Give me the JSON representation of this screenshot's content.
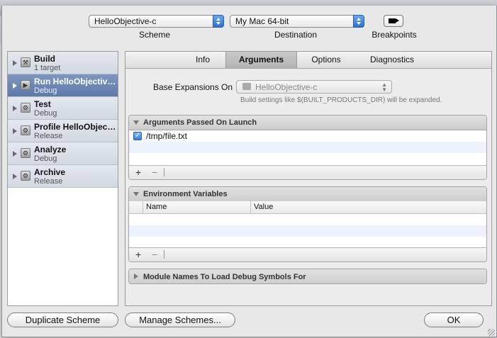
{
  "toolbar": {
    "scheme_value": "HelloObjective-c",
    "scheme_label": "Scheme",
    "destination_value": "My Mac 64-bit",
    "destination_label": "Destination",
    "breakpoints_label": "Breakpoints"
  },
  "sidebar": {
    "items": [
      {
        "name": "Build",
        "sub": "1 target",
        "icon": "hammer-icon",
        "selected": false
      },
      {
        "name": "Run HelloObjective-c",
        "sub": "Debug",
        "icon": "run-icon",
        "selected": true
      },
      {
        "name": "Test",
        "sub": "Debug",
        "icon": "wrench-icon",
        "selected": false
      },
      {
        "name": "Profile HelloObject…",
        "sub": "Release",
        "icon": "instruments-icon",
        "selected": false
      },
      {
        "name": "Analyze",
        "sub": "Debug",
        "icon": "analyze-icon",
        "selected": false
      },
      {
        "name": "Archive",
        "sub": "Release",
        "icon": "archive-icon",
        "selected": false
      }
    ]
  },
  "tabs": [
    {
      "label": "Info",
      "selected": false
    },
    {
      "label": "Arguments",
      "selected": true
    },
    {
      "label": "Options",
      "selected": false
    },
    {
      "label": "Diagnostics",
      "selected": false
    }
  ],
  "arguments": {
    "base_label": "Base Expansions On",
    "base_value": "HelloObjective-c",
    "base_hint": "Build settings like $(BUILT_PRODUCTS_DIR) will be expanded.",
    "args_group_title": "Arguments Passed On Launch",
    "args": [
      {
        "checked": true,
        "value": "/tmp/file.txt"
      }
    ],
    "env_group_title": "Environment Variables",
    "env_columns": [
      "Name",
      "Value"
    ],
    "modules_group_title": "Module Names To Load Debug Symbols For",
    "add_symbol": "+",
    "remove_symbol": "−"
  },
  "buttons": {
    "duplicate": "Duplicate Scheme",
    "manage": "Manage Schemes...",
    "ok": "OK"
  }
}
